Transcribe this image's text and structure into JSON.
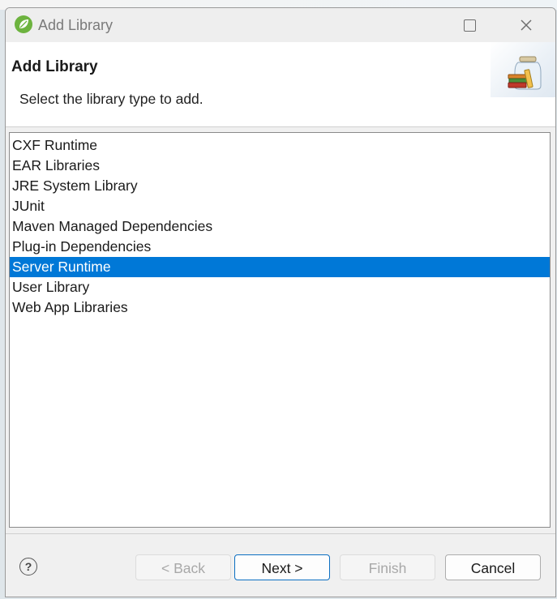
{
  "window": {
    "title": "Add Library",
    "icon": "spring-leaf-icon",
    "controls": [
      "maximize-icon",
      "close-icon"
    ]
  },
  "banner": {
    "title": "Add Library",
    "description": "Select the library type to add.",
    "icon": "library-jar-icon"
  },
  "library_list": {
    "items": [
      {
        "label": "CXF Runtime",
        "selected": false
      },
      {
        "label": "EAR Libraries",
        "selected": false
      },
      {
        "label": "JRE System Library",
        "selected": false
      },
      {
        "label": "JUnit",
        "selected": false
      },
      {
        "label": "Maven Managed Dependencies",
        "selected": false
      },
      {
        "label": "Plug-in Dependencies",
        "selected": false
      },
      {
        "label": "Server Runtime",
        "selected": true
      },
      {
        "label": "User Library",
        "selected": false
      },
      {
        "label": "Web App Libraries",
        "selected": false
      }
    ],
    "selection_color": "#0078d7"
  },
  "footer": {
    "help_label": "?",
    "back_label": "< Back",
    "next_label": "Next >",
    "finish_label": "Finish",
    "cancel_label": "Cancel"
  }
}
